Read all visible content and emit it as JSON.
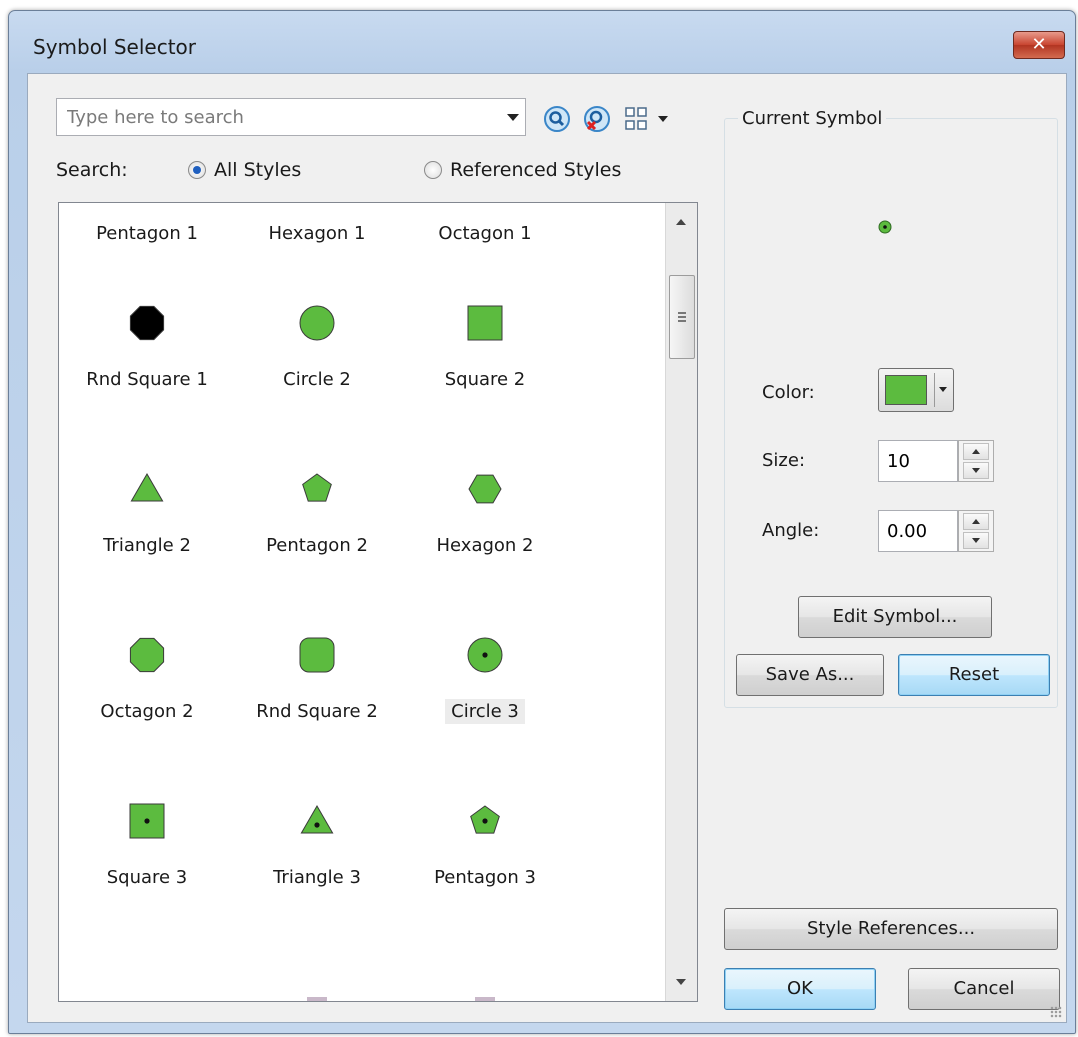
{
  "window": {
    "title": "Symbol Selector",
    "close_glyph": "✕"
  },
  "search": {
    "placeholder": "Type here to search",
    "label": "Search:",
    "options": [
      "All Styles",
      "Referenced Styles"
    ],
    "selected": "All Styles",
    "icons": [
      "search-icon",
      "clear-search-icon",
      "view-options-icon"
    ]
  },
  "symbols": [
    {
      "label": "Pentagon 1",
      "shape": "none"
    },
    {
      "label": "Hexagon 1",
      "shape": "none"
    },
    {
      "label": "Octagon 1",
      "shape": "none"
    },
    {
      "label": "Rnd Square 1",
      "shape": "octagon",
      "fill": "#000000",
      "dot": false
    },
    {
      "label": "Circle 2",
      "shape": "circle",
      "fill": "#5cbb3f",
      "dot": false
    },
    {
      "label": "Square 2",
      "shape": "square",
      "fill": "#5cbb3f",
      "dot": false
    },
    {
      "label": "Triangle 2",
      "shape": "triangle",
      "fill": "#5cbb3f",
      "dot": false
    },
    {
      "label": "Pentagon 2",
      "shape": "pentagon",
      "fill": "#5cbb3f",
      "dot": false
    },
    {
      "label": "Hexagon 2",
      "shape": "hexagon",
      "fill": "#5cbb3f",
      "dot": false
    },
    {
      "label": "Octagon 2",
      "shape": "octagon",
      "fill": "#5cbb3f",
      "dot": false
    },
    {
      "label": "Rnd Square 2",
      "shape": "rndsquare",
      "fill": "#5cbb3f",
      "dot": false
    },
    {
      "label": "Circle 3",
      "shape": "circle",
      "fill": "#5cbb3f",
      "dot": true,
      "selected": true
    },
    {
      "label": "Square 3",
      "shape": "square",
      "fill": "#5cbb3f",
      "dot": true
    },
    {
      "label": "Triangle 3",
      "shape": "triangle",
      "fill": "#5cbb3f",
      "dot": true
    },
    {
      "label": "Pentagon 3",
      "shape": "pentagon",
      "fill": "#5cbb3f",
      "dot": true
    }
  ],
  "current_symbol": {
    "group_title": "Current Symbol",
    "preview_shape": "circle",
    "color_label": "Color:",
    "color_value": "#5cbb3f",
    "size_label": "Size:",
    "size_value": "10",
    "angle_label": "Angle:",
    "angle_value": "0.00",
    "edit_button": "Edit Symbol...",
    "save_as_button": "Save As...",
    "reset_button": "Reset"
  },
  "footer": {
    "style_references_button": "Style References...",
    "ok_button": "OK",
    "cancel_button": "Cancel"
  },
  "colors": {
    "accent": "#5cbb3f",
    "title_bar": "#c8daf0",
    "client": "#f0f0f0"
  }
}
